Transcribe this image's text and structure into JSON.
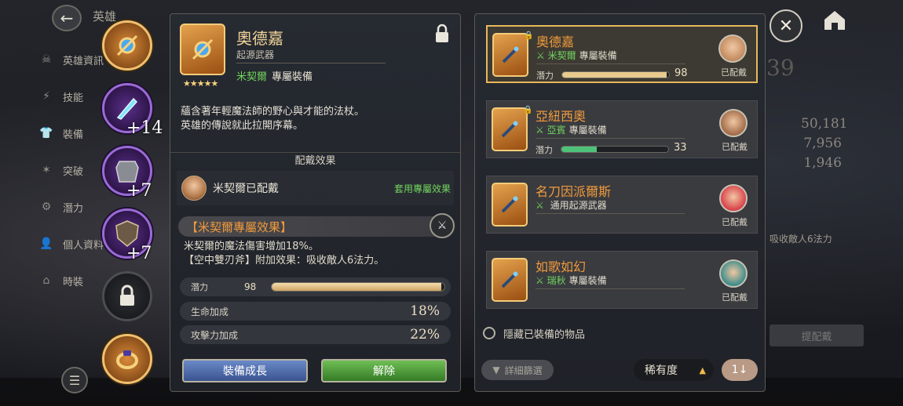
{
  "background": {
    "title": "英雄",
    "nav_items": [
      "英雄資訊",
      "技能",
      "裝備",
      "突破",
      "潛力",
      "個人資料",
      "時裝"
    ],
    "stats": [
      "50,181",
      "7,956",
      "1,946"
    ],
    "big_number": "39",
    "absorb_text": "吸收敵人6法力",
    "side_button": "提配戴"
  },
  "equipment_slots": [
    {
      "kind": "weapon",
      "plus": ""
    },
    {
      "kind": "sword",
      "plus": "+14"
    },
    {
      "kind": "armor",
      "plus": "+7"
    },
    {
      "kind": "shield",
      "plus": "+7"
    },
    {
      "kind": "locked",
      "plus": ""
    },
    {
      "kind": "ring",
      "plus": ""
    }
  ],
  "detail": {
    "name": "奧德嘉",
    "type": "起源武器",
    "stars": "★★★★★",
    "owner": "米契爾",
    "owner_tag": "專屬裝備",
    "description": [
      "蘊含著年輕魔法師的野心與才能的法杖。",
      "英雄的傳說就此拉開序幕。"
    ],
    "effect_section": "配戴效果",
    "equipped_status": "米契爾已配戴",
    "apply_exclusive": "套用專屬效果",
    "exclusive_title": "【米契爾專屬效果】",
    "exclusive_desc": [
      "米契爾的魔法傷害增加18%。",
      "【空中雙刃斧】附加效果：吸收敵人6法力。"
    ],
    "potential_label": "潛力",
    "potential_value": 98,
    "stats": [
      {
        "label": "生命加成",
        "value": "18%"
      },
      {
        "label": "攻擊力加成",
        "value": "22%"
      }
    ],
    "btn_upgrade": "裝備成長",
    "btn_unequip": "解除"
  },
  "list": {
    "items": [
      {
        "name": "奧德嘉",
        "owner": "米契爾",
        "tag": "專屬裝備",
        "has_potential": true,
        "potential": 98,
        "equipped": "已配戴",
        "avatar_color": "#c28a5e",
        "selected": true,
        "bar_color": "#e8c98e"
      },
      {
        "name": "亞紐西奧",
        "owner": "亞賓",
        "tag": "專屬裝備",
        "has_potential": true,
        "potential": 33,
        "equipped": "已配戴",
        "avatar_color": "#a06a48",
        "selected": false,
        "bar_color": "#4fc27a"
      },
      {
        "name": "名刀因派爾斯",
        "owner": "",
        "tag": "通用起源武器",
        "has_potential": false,
        "potential": null,
        "equipped": "已配戴",
        "avatar_color": "#d8404a",
        "selected": false,
        "bar_color": ""
      },
      {
        "name": "如歌如幻",
        "owner": "瑞秋",
        "tag": "專屬裝備",
        "has_potential": false,
        "potential": null,
        "equipped": "已配戴",
        "avatar_color": "#3c8c8a",
        "selected": false,
        "bar_color": ""
      }
    ],
    "potential_label": "潛力",
    "hide_equipped": "隱藏已裝備的物品",
    "filter": "詳細篩選",
    "sort": "稀有度",
    "order": "1↓"
  },
  "colors": {
    "accent": "#f09a3c",
    "green": "#72d45e",
    "gold": "#e9b85a"
  }
}
